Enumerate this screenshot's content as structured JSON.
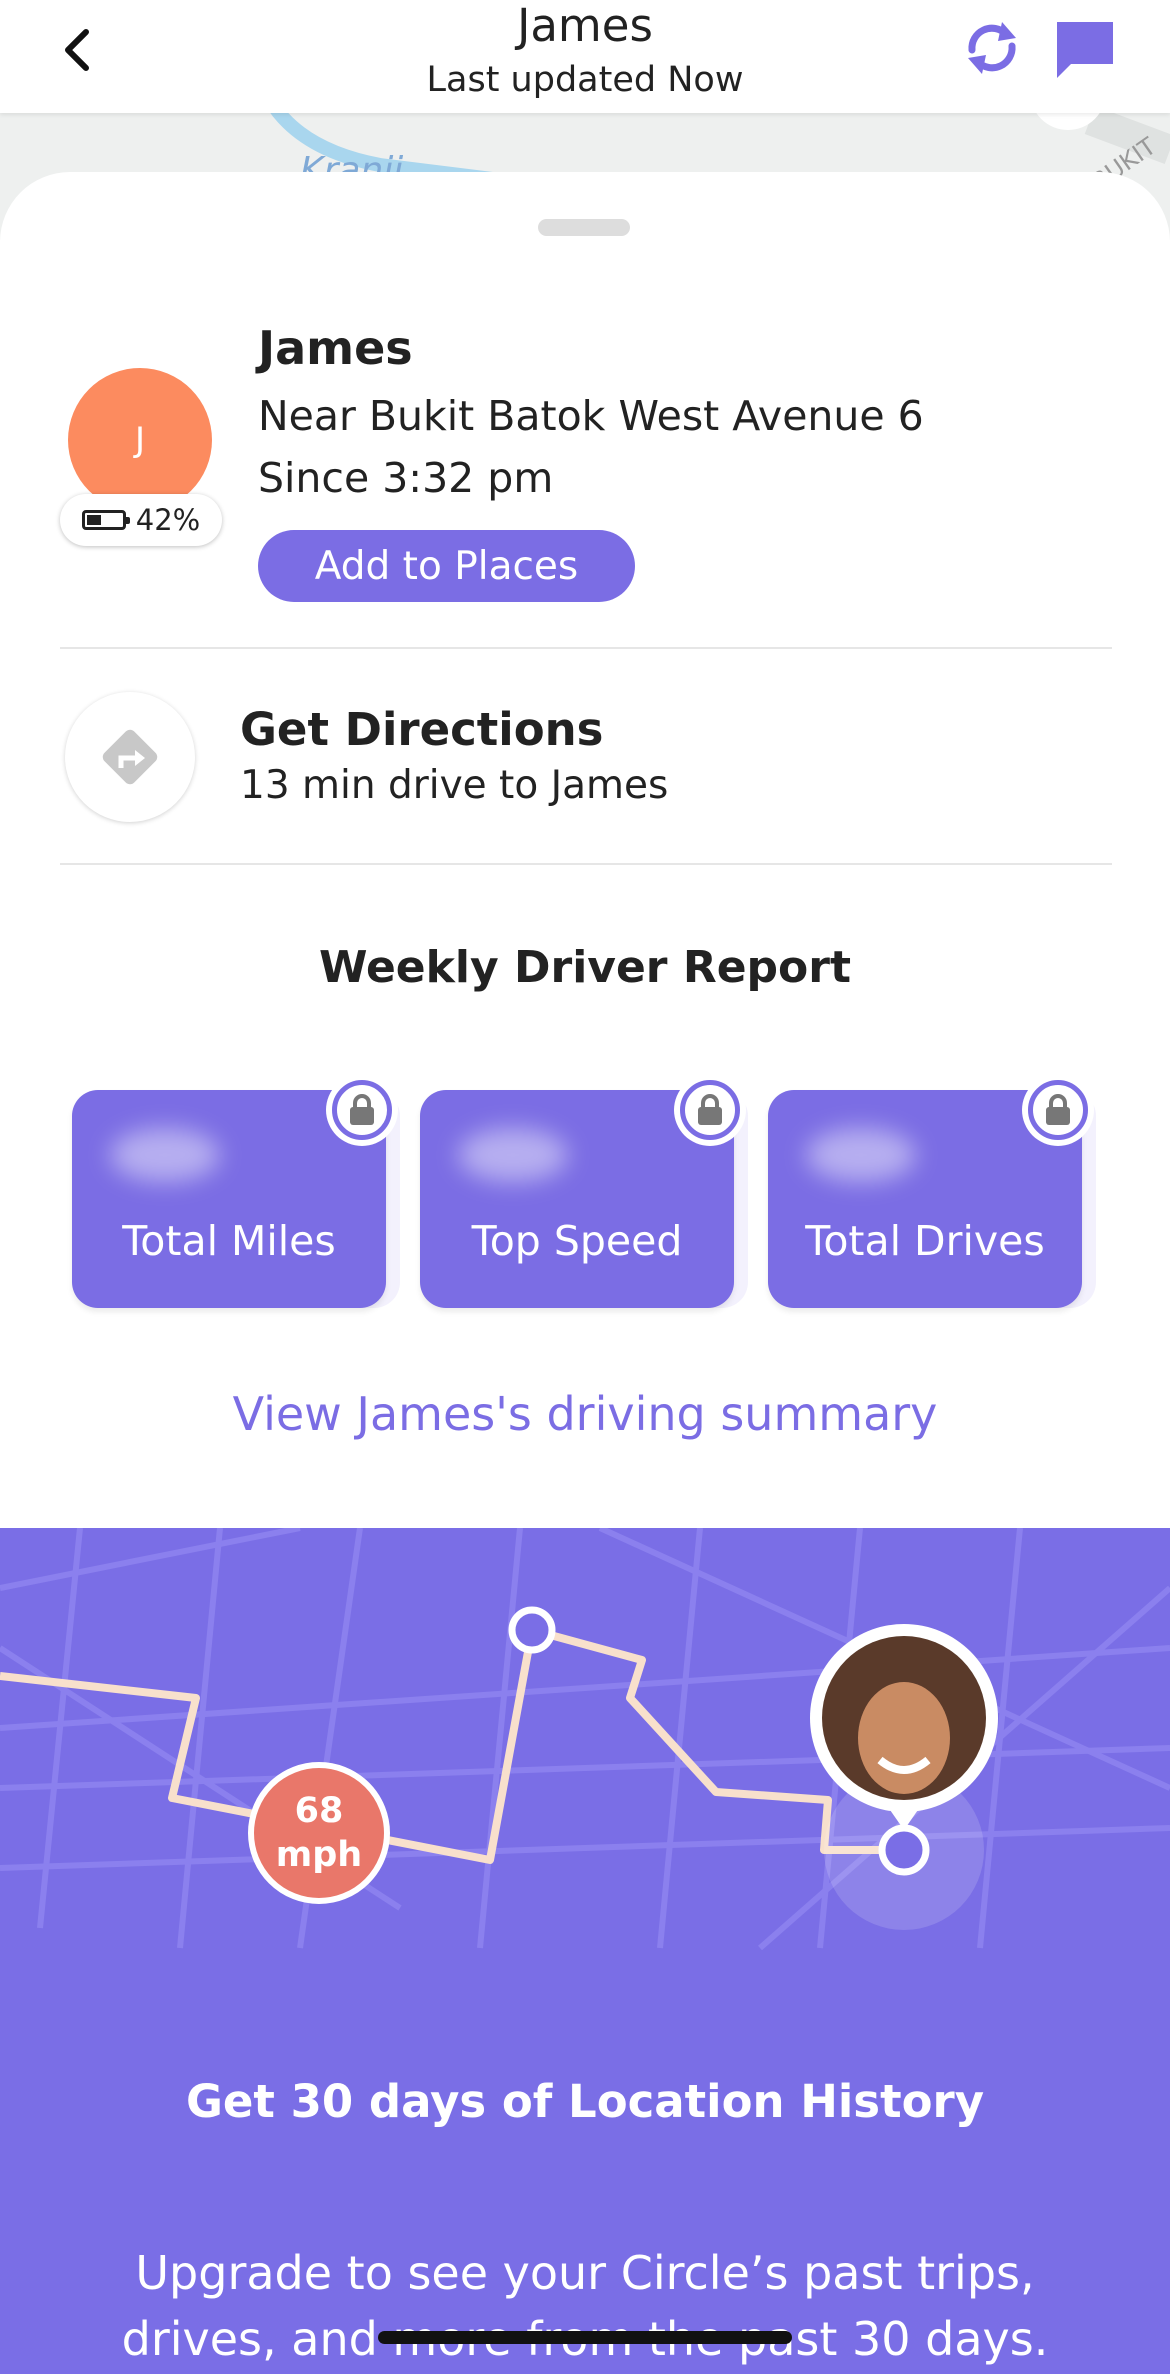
{
  "header": {
    "title": "James",
    "subtitle": "Last updated Now",
    "back_icon": "chevron-left-icon",
    "refresh_icon": "refresh-icon",
    "chat_icon": "chat-bubble-icon",
    "accent": "#7b6de4"
  },
  "map": {
    "label_fragment": "Kranji",
    "road_fragment": "BUKIT"
  },
  "member": {
    "initial": "J",
    "name": "James",
    "location": "Near Bukit Batok West Avenue 6",
    "since": "Since 3:32 pm",
    "battery": "42%",
    "avatar_color": "#fc8b5f",
    "add_places_label": "Add to Places"
  },
  "directions": {
    "icon": "directions-sign-icon",
    "title": "Get Directions",
    "subtitle": "13 min drive to James"
  },
  "report": {
    "title": "Weekly Driver Report",
    "cards": [
      {
        "label": "Total Miles",
        "locked": true
      },
      {
        "label": "Top Speed",
        "locked": true
      },
      {
        "label": "Total Drives",
        "locked": true
      }
    ],
    "summary_link": "View James's driving summary"
  },
  "promo": {
    "speed_value": "68",
    "speed_unit": "mph",
    "title": "Get 30 days of Location History",
    "text": "Upgrade to see your Circle’s past trips, drives, and more from the past 30 days.",
    "background": "#7a6ee6"
  }
}
